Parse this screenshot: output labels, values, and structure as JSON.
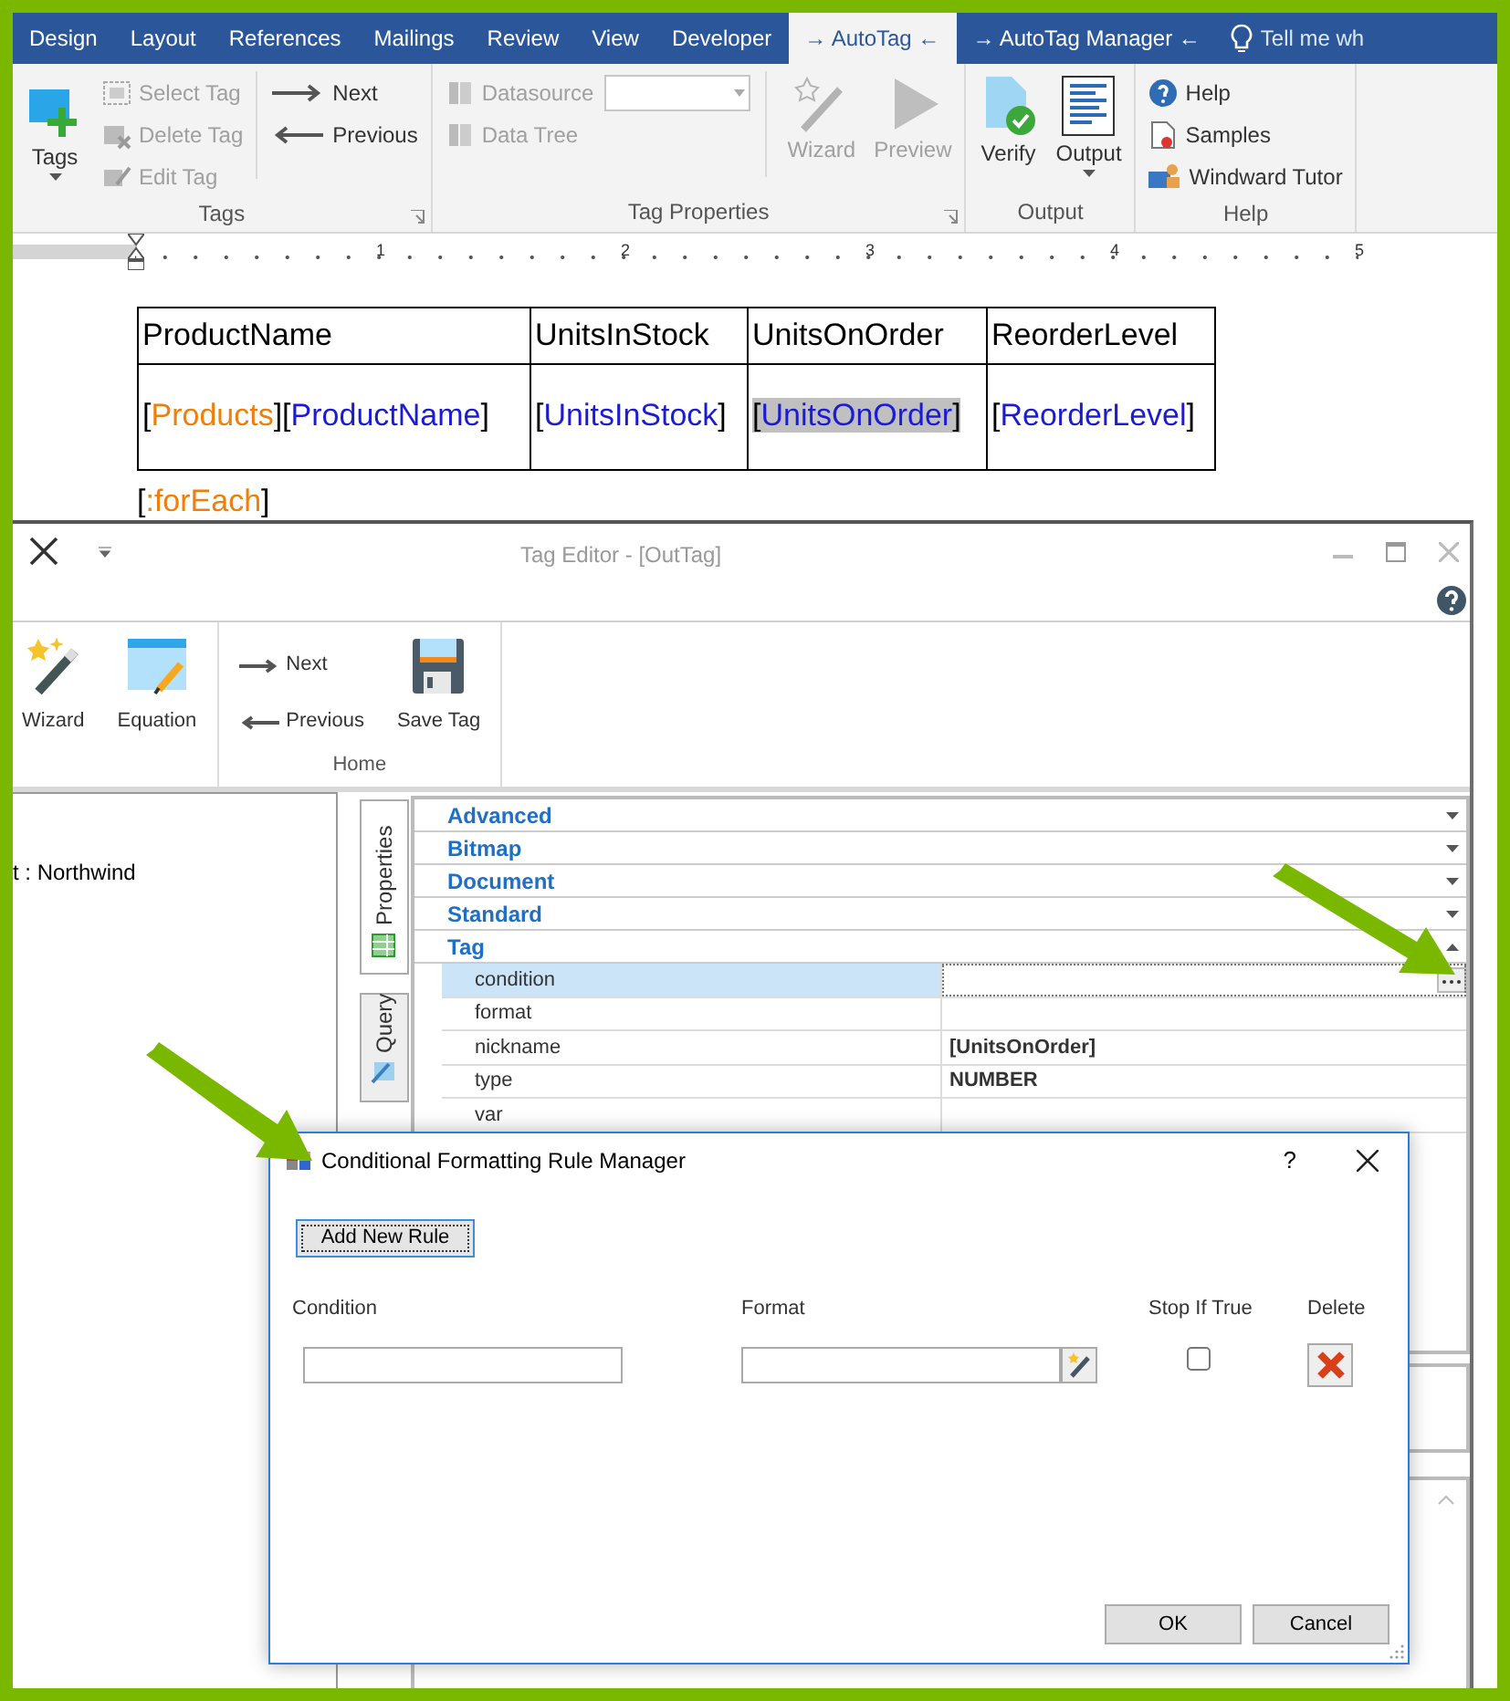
{
  "ribbon": {
    "tabs": [
      {
        "label": "Design",
        "selected": false
      },
      {
        "label": "Layout",
        "selected": false
      },
      {
        "label": "References",
        "selected": false
      },
      {
        "label": "Mailings",
        "selected": false
      },
      {
        "label": "Review",
        "selected": false
      },
      {
        "label": "View",
        "selected": false
      },
      {
        "label": "Developer",
        "selected": false
      },
      {
        "label": "→ AutoTag ←",
        "selected": true
      },
      {
        "label": "→ AutoTag Manager ←",
        "selected": false
      }
    ],
    "tell_me": "Tell me wh",
    "groups": [
      {
        "label": "Tags",
        "launcher": true,
        "items": [
          {
            "kind": "large",
            "label": "Tags",
            "disabled": false
          },
          {
            "kind": "small",
            "label": "Select Tag",
            "disabled": true
          },
          {
            "kind": "small",
            "label": "Delete Tag",
            "disabled": true
          },
          {
            "kind": "small",
            "label": "Edit Tag",
            "disabled": true
          },
          {
            "kind": "small",
            "label": "Next",
            "disabled": false
          },
          {
            "kind": "small",
            "label": "Previous",
            "disabled": false
          }
        ]
      },
      {
        "label": "Tag Properties",
        "launcher": true,
        "items": [
          {
            "kind": "combo",
            "label": "Datasource",
            "disabled": true
          },
          {
            "kind": "small",
            "label": "Data Tree",
            "disabled": true
          },
          {
            "kind": "large",
            "label": "Wizard",
            "disabled": true
          },
          {
            "kind": "large",
            "label": "Preview",
            "disabled": true
          }
        ]
      },
      {
        "label": "Output",
        "items": [
          {
            "kind": "large",
            "label": "Verify",
            "disabled": false
          },
          {
            "kind": "large",
            "label": "Output",
            "disabled": false
          }
        ]
      },
      {
        "label": "Help",
        "items": [
          {
            "kind": "small",
            "label": "Help",
            "disabled": false
          },
          {
            "kind": "small",
            "label": "Samples",
            "disabled": false
          },
          {
            "kind": "small",
            "label": "Windward Tutor",
            "disabled": false
          }
        ]
      }
    ]
  },
  "ruler": {
    "numbers": [
      "1",
      "2",
      "3",
      "4",
      "5"
    ]
  },
  "document": {
    "table": {
      "header": [
        "ProductName",
        "UnitsInStock",
        "UnitsOnOrder",
        "ReorderLevel"
      ],
      "row": [
        {
          "selected": false,
          "parts": [
            {
              "kind": "bracket",
              "text": "["
            },
            {
              "kind": "source",
              "text": "Products"
            },
            {
              "kind": "bracket",
              "text": "]["
            },
            {
              "kind": "field",
              "text": "ProductName"
            },
            {
              "kind": "bracket",
              "text": "]"
            }
          ]
        },
        {
          "selected": false,
          "parts": [
            {
              "kind": "bracket",
              "text": "["
            },
            {
              "kind": "field",
              "text": "UnitsInStock"
            },
            {
              "kind": "bracket",
              "text": "]"
            }
          ]
        },
        {
          "selected": true,
          "parts": [
            {
              "kind": "bracket",
              "text": "["
            },
            {
              "kind": "field",
              "text": "UnitsOnOrder"
            },
            {
              "kind": "bracket",
              "text": "]"
            }
          ]
        },
        {
          "selected": false,
          "parts": [
            {
              "kind": "bracket",
              "text": "["
            },
            {
              "kind": "field",
              "text": "ReorderLevel"
            },
            {
              "kind": "bracket",
              "text": "]"
            }
          ]
        }
      ]
    },
    "after": [
      {
        "kind": "bracket",
        "text": "["
      },
      {
        "kind": "source",
        "text": ":forEach"
      },
      {
        "kind": "bracket",
        "text": "]"
      }
    ]
  },
  "tag_editor": {
    "title": "Tag Editor - [OutTag]",
    "toolbar": [
      {
        "items": [
          {
            "kind": "large",
            "label": "Wizard"
          },
          {
            "kind": "large",
            "label": "Equation"
          }
        ]
      },
      {
        "label": "Home",
        "items": [
          {
            "kind": "small",
            "label": "Next"
          },
          {
            "kind": "small",
            "label": "Previous"
          },
          {
            "kind": "large",
            "label": "Save Tag"
          }
        ]
      }
    ],
    "left_panel_text": "t : Northwind",
    "side_tabs": [
      {
        "label": "Properties",
        "selected": true
      },
      {
        "label": "Query",
        "selected": false
      }
    ],
    "categories": [
      {
        "label": "Advanced",
        "expanded": false
      },
      {
        "label": "Bitmap",
        "expanded": false
      },
      {
        "label": "Document",
        "expanded": false
      },
      {
        "label": "Standard",
        "expanded": false
      },
      {
        "label": "Tag",
        "expanded": true,
        "rows": [
          {
            "name": "condition",
            "selected": true
          },
          {
            "name": "format",
            "selected": false
          },
          {
            "name": "nickname",
            "value": "[UnitsOnOrder]",
            "selected": false
          },
          {
            "name": "type",
            "value": "NUMBER",
            "selected": false
          },
          {
            "name": "var",
            "selected": false
          }
        ]
      }
    ]
  },
  "dialog": {
    "title": "Conditional Formatting Rule Manager",
    "help": "?",
    "add_button": "Add New Rule",
    "columns": [
      "Condition",
      "Format",
      "Stop If True",
      "Delete"
    ],
    "rules": [
      {
        "stop_if_true": false
      }
    ],
    "buttons": [
      "OK",
      "Cancel"
    ]
  }
}
